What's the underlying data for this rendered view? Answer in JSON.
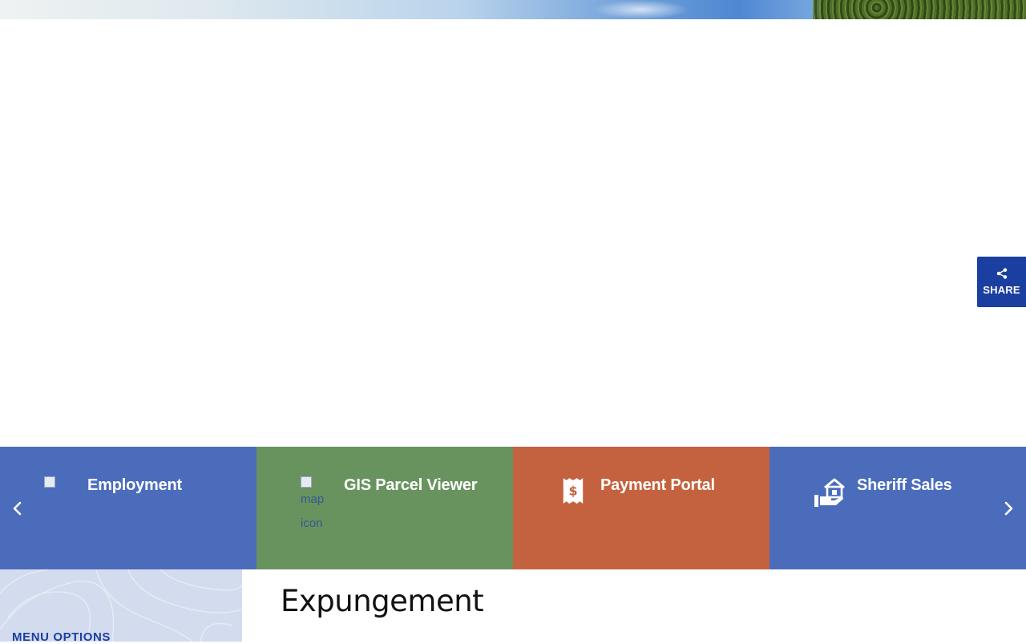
{
  "share": {
    "label": "SHARE",
    "icon": "share-icon"
  },
  "quick_links": [
    {
      "label": "Employment",
      "icon": "employment-icon",
      "image_alt": ""
    },
    {
      "label": "GIS Parcel Viewer",
      "icon": "map-icon",
      "image_alt": "map icon"
    },
    {
      "label": "Payment Portal",
      "icon": "receipt-dollar-icon",
      "image_alt": ""
    },
    {
      "label": "Sheriff Sales",
      "icon": "house-in-hand-icon",
      "image_alt": ""
    }
  ],
  "carousel": {
    "prev_icon": "chevron-left-icon",
    "next_icon": "chevron-right-icon"
  },
  "sidebar": {
    "heading": "MENU OPTIONS"
  },
  "main": {
    "title": "Expungement"
  },
  "colors": {
    "brand_blue": "#1b3fa0",
    "tile_blue": "#4a6cbb",
    "tile_green": "#68935f",
    "tile_orange": "#c4623f",
    "sidebar_bg": "#d3dcee"
  }
}
